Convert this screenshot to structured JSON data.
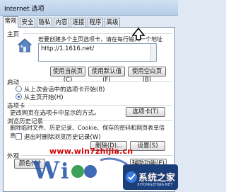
{
  "window": {
    "title": "Internet 选项"
  },
  "tabs": [
    {
      "label": "常规",
      "active": true
    },
    {
      "label": "安全"
    },
    {
      "label": "隐私"
    },
    {
      "label": "内容"
    },
    {
      "label": "连接"
    },
    {
      "label": "程序"
    },
    {
      "label": "高级"
    }
  ],
  "home": {
    "section": "主页",
    "hint": "若要创建多个主页选项卡，请在每行输入一个地址",
    "url": "http://1.1616.net/",
    "use_current": "使用当前页(C)",
    "use_default": "使用默认值(F)",
    "use_blank": "使用空白页(B)"
  },
  "startup": {
    "section": "启动",
    "opt_last": "从上次会话中的选项卡开始(B)",
    "opt_home": "从主页开始(H)"
  },
  "tabs_section": {
    "section": "选项卡",
    "desc": "更改网页在选项卡中显示的方式。",
    "button": "选项卡(T)"
  },
  "history": {
    "section": "浏览历史记录",
    "desc": "删除临时文件、历史记录、Cookie、保存的密码和网页表单信息。",
    "exit_delete": "退出时删除浏览历史记录(W)",
    "delete_btn": "删除(D)...",
    "settings_btn": "设置(S)"
  },
  "appearance": {
    "section": "外观",
    "colors_btn": "颜色(O)",
    "accessibility_btn": "辅助功能(E)"
  },
  "watermark": {
    "site": "www.win7zhijia.cn",
    "brand": "系统之家",
    "brand_url": "XITONGZHIJIA.NET"
  }
}
